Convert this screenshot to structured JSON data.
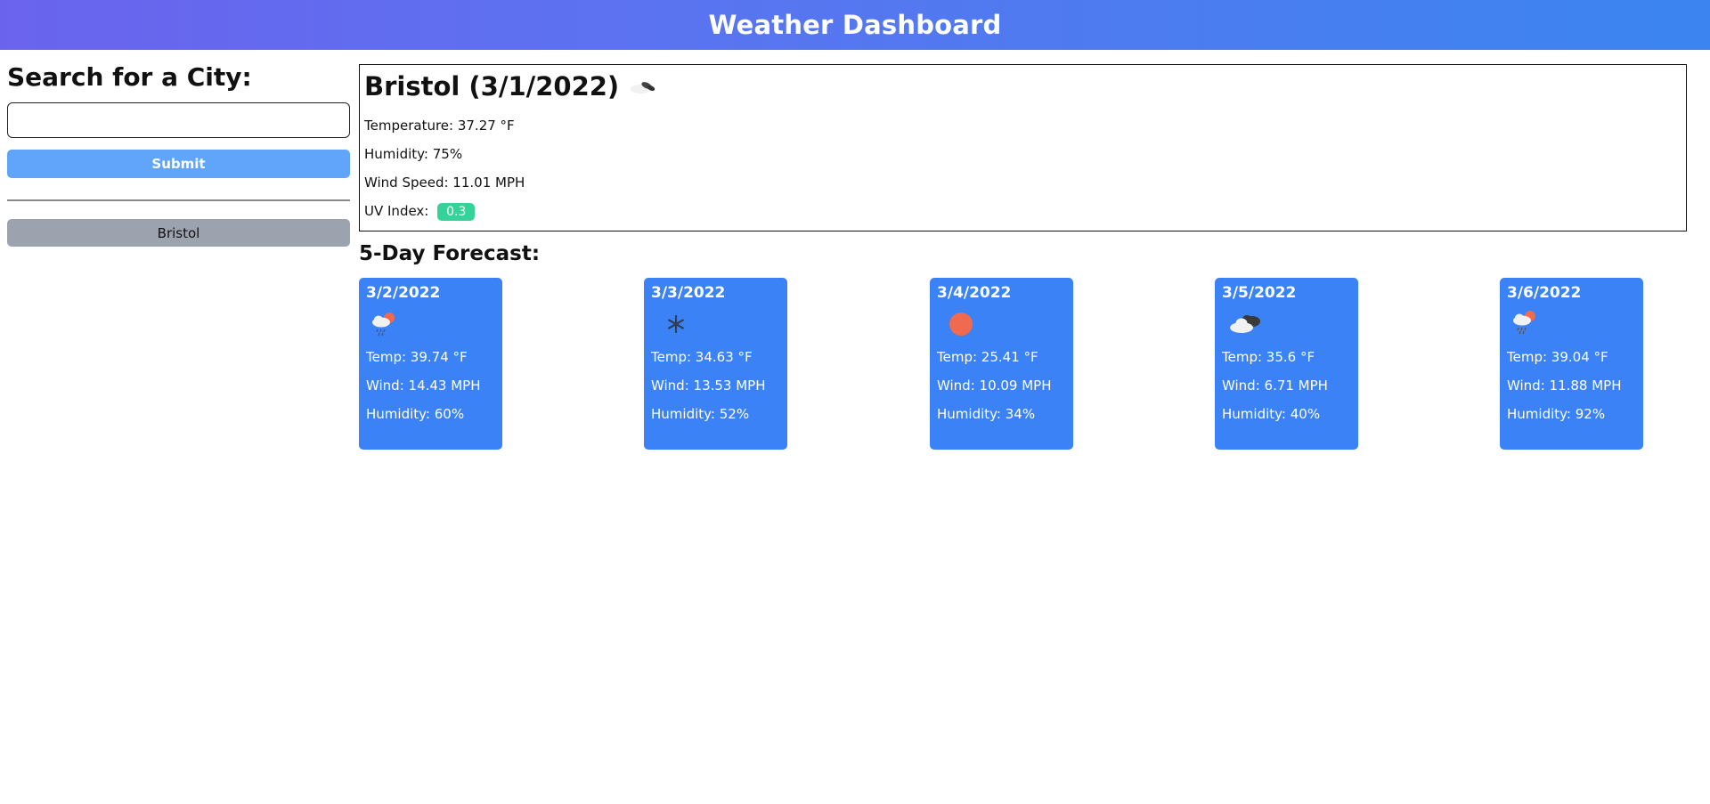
{
  "header": {
    "title": "Weather Dashboard"
  },
  "sidebar": {
    "heading": "Search for a City:",
    "search_value": "",
    "search_placeholder": "",
    "submit_label": "Submit",
    "history": [
      "Bristol"
    ]
  },
  "current": {
    "title": "Bristol (3/1/2022)",
    "icon": "broken-clouds-icon",
    "temperature": "Temperature: 37.27 °F",
    "humidity": "Humidity: 75%",
    "wind": "Wind Speed: 11.01 MPH",
    "uv_label": "UV Index:",
    "uv_value": "0.3",
    "uv_color": "#34d399"
  },
  "forecast": {
    "heading": "5-Day Forecast:",
    "days": [
      {
        "date": "3/2/2022",
        "icon": "rain-sun-icon",
        "temp": "Temp: 39.74 °F",
        "wind": "Wind: 14.43 MPH",
        "humidity": "Humidity: 60%"
      },
      {
        "date": "3/3/2022",
        "icon": "snowflake-icon",
        "temp": "Temp: 34.63 °F",
        "wind": "Wind: 13.53 MPH",
        "humidity": "Humidity: 52%"
      },
      {
        "date": "3/4/2022",
        "icon": "sun-icon",
        "temp": "Temp: 25.41 °F",
        "wind": "Wind: 10.09 MPH",
        "humidity": "Humidity: 34%"
      },
      {
        "date": "3/5/2022",
        "icon": "broken-clouds-icon",
        "temp": "Temp: 35.6 °F",
        "wind": "Wind: 6.71 MPH",
        "humidity": "Humidity: 40%"
      },
      {
        "date": "3/6/2022",
        "icon": "rain-sun-icon",
        "temp": "Temp: 39.04 °F",
        "wind": "Wind: 11.88 MPH",
        "humidity": "Humidity: 92%"
      }
    ]
  },
  "colors": {
    "header_gradient_start": "#6a63ee",
    "header_gradient_end": "#3b85f0",
    "submit_button": "#60a5fa",
    "history_button": "#9ca3af",
    "card_background": "#3b82f6"
  }
}
